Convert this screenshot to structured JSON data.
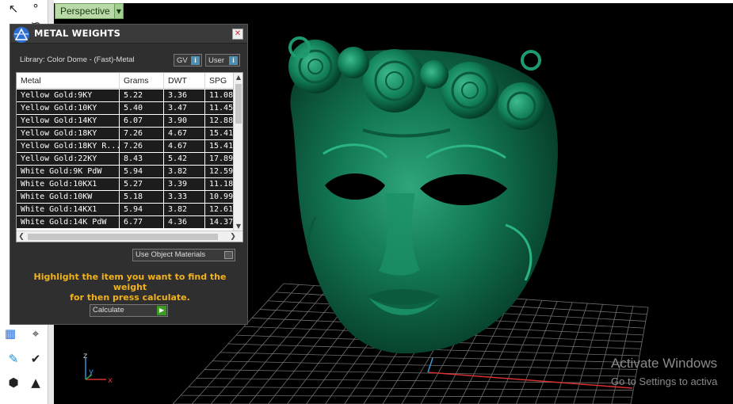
{
  "viewport": {
    "view_label": "Perspective",
    "axis_labels": {
      "z": "z",
      "y": "y",
      "x": "x"
    }
  },
  "panel": {
    "title": "METAL WEIGHTS",
    "library": "Library: Color Dome - (Fast)-Metal",
    "gv_label": "GV",
    "user_label": "User",
    "info_glyph": "i",
    "columns": [
      "Metal",
      "Grams",
      "DWT",
      "SPG"
    ],
    "rows": [
      [
        "Yellow Gold:9KY",
        "5.22",
        "3.36",
        "11.08"
      ],
      [
        "Yellow Gold:10KY",
        "5.40",
        "3.47",
        "11.45"
      ],
      [
        "Yellow Gold:14KY",
        "6.07",
        "3.90",
        "12.88"
      ],
      [
        "Yellow Gold:18KY",
        "7.26",
        "4.67",
        "15.41"
      ],
      [
        "Yellow Gold:18KY R...",
        "7.26",
        "4.67",
        "15.41"
      ],
      [
        "Yellow Gold:22KY",
        "8.43",
        "5.42",
        "17.89"
      ],
      [
        "White Gold:9K PdW",
        "5.94",
        "3.82",
        "12.59"
      ],
      [
        "White Gold:10KX1",
        "5.27",
        "3.39",
        "11.18"
      ],
      [
        "White Gold:10KW",
        "5.18",
        "3.33",
        "10.99"
      ],
      [
        "White Gold:14KX1",
        "5.94",
        "3.82",
        "12.61"
      ],
      [
        "White Gold:14K PdW",
        "6.77",
        "4.36",
        "14.37"
      ]
    ],
    "use_object_materials": "Use Object Materials",
    "hint_line1": "Highlight the item you want to find the weight",
    "hint_line2": "for then press calculate.",
    "calculate_label": "Calculate"
  },
  "watermark": {
    "line1": "Activate Windows",
    "line2": "Go to Settings to activa"
  },
  "colors": {
    "mask_green": "#0f7a55",
    "hint_yellow": "#f2b21c",
    "panel_bg": "#2f2f2f",
    "view_tab": "#b9d9a8"
  }
}
